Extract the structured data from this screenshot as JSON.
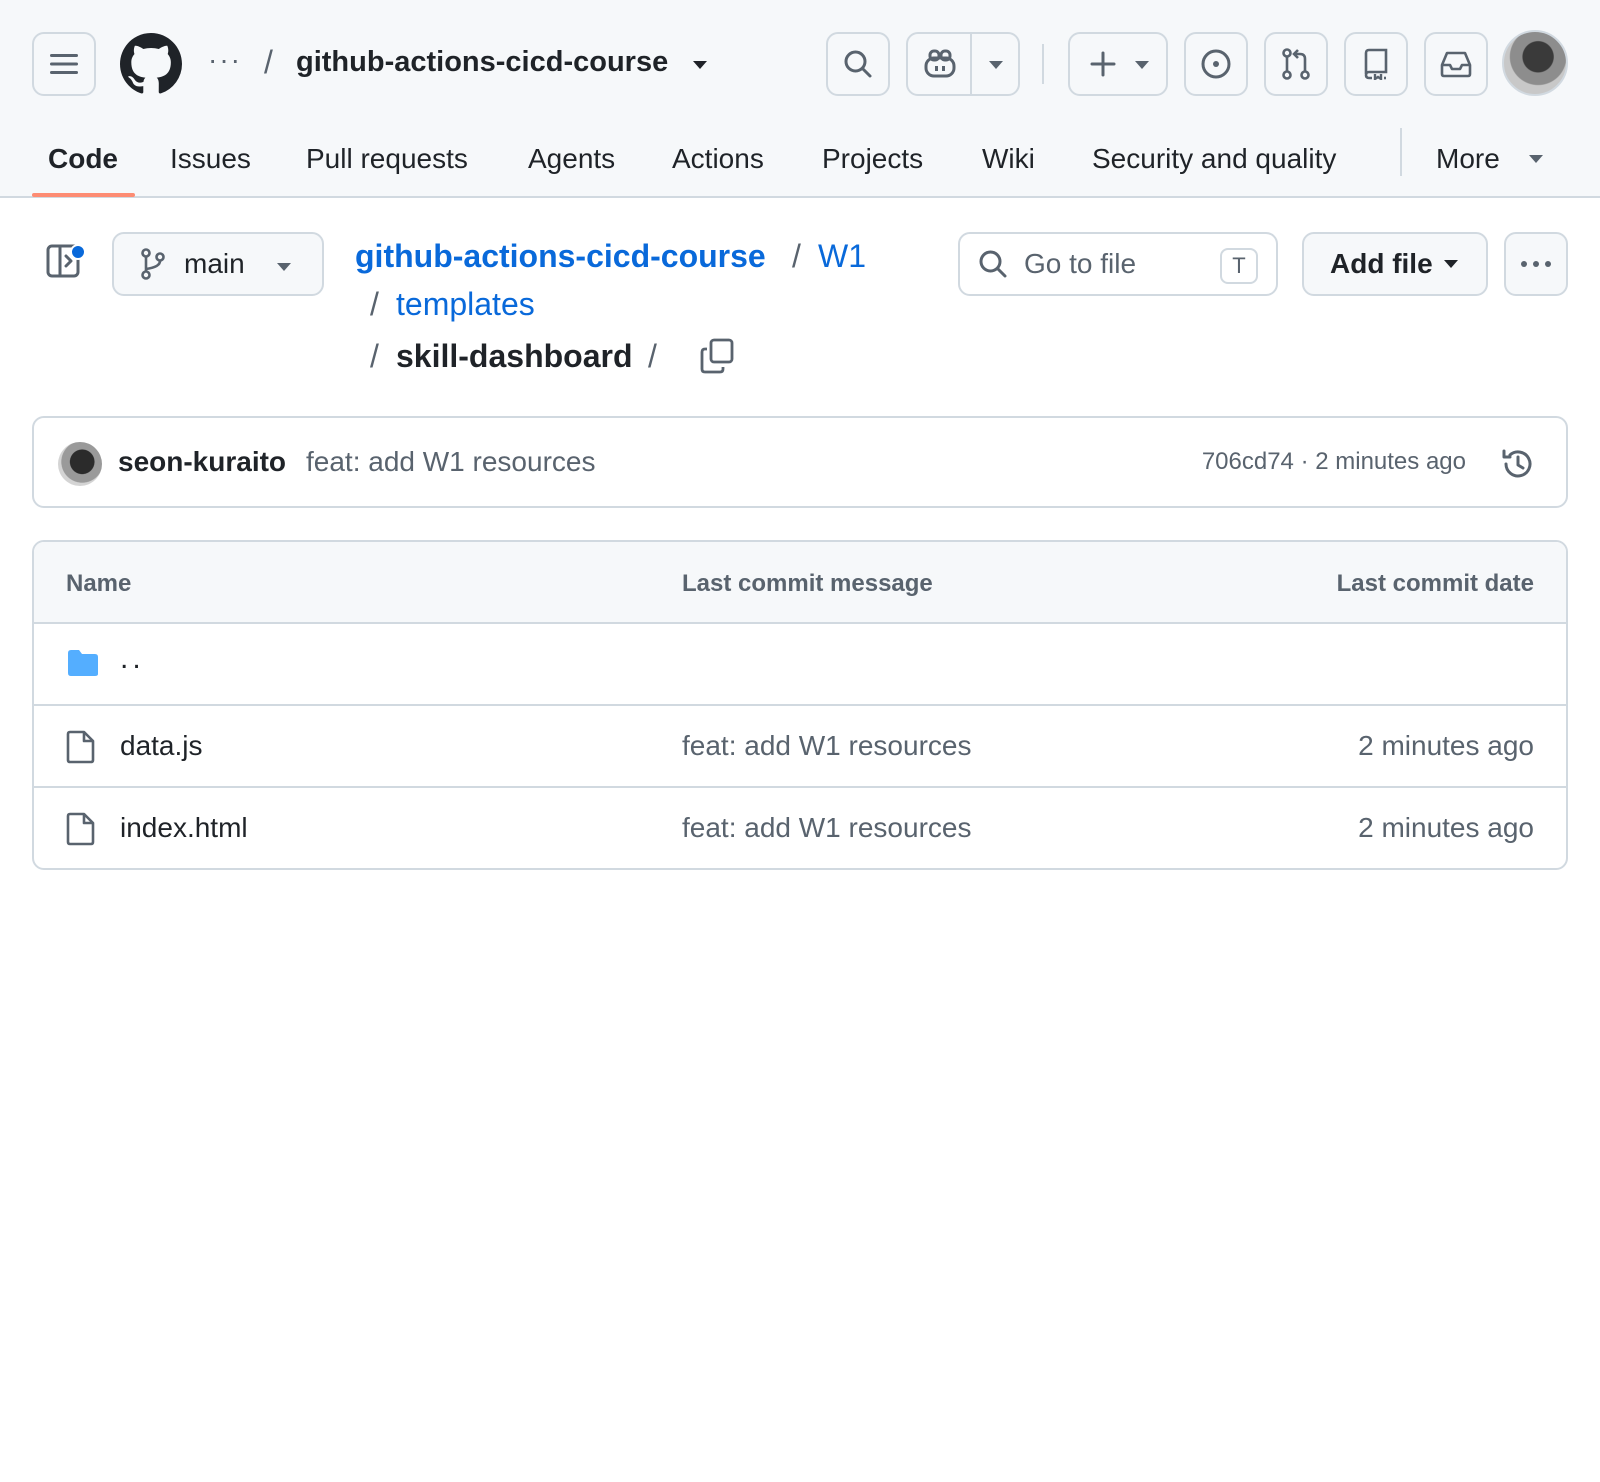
{
  "header": {
    "context_dots": "···",
    "slash": "/",
    "repo_name": "github-actions-cicd-course"
  },
  "tabs": [
    {
      "label": "Code",
      "selected": true
    },
    {
      "label": "Issues"
    },
    {
      "label": "Pull requests"
    },
    {
      "label": "Agents"
    },
    {
      "label": "Actions"
    },
    {
      "label": "Projects"
    },
    {
      "label": "Wiki"
    },
    {
      "label": "Security and quality"
    }
  ],
  "more_tab": "More",
  "branch": {
    "name": "main"
  },
  "breadcrumb": {
    "root": "github-actions-cicd-course",
    "w1": "W1",
    "templates": "templates",
    "current": "skill-dashboard",
    "slash": "/"
  },
  "goto": {
    "placeholder": "Go to file",
    "shortcut": "T"
  },
  "add_file": "Add file",
  "latest_commit": {
    "author": "seon-kuraito",
    "message": "feat: add W1 resources",
    "meta": "706cd74 · 2 minutes ago"
  },
  "table": {
    "headers": {
      "name": "Name",
      "message": "Last commit message",
      "date": "Last commit date"
    },
    "parent": "..",
    "rows": [
      {
        "name": "data.js",
        "message": "feat: add W1 resources",
        "date": "2 minutes ago"
      },
      {
        "name": "index.html",
        "message": "feat: add W1 resources",
        "date": "2 minutes ago"
      }
    ]
  },
  "colors": {
    "accent": "#0969da",
    "tab_underline": "#fd8c73",
    "folder": "#54aeff",
    "border": "#d1d9e0"
  }
}
